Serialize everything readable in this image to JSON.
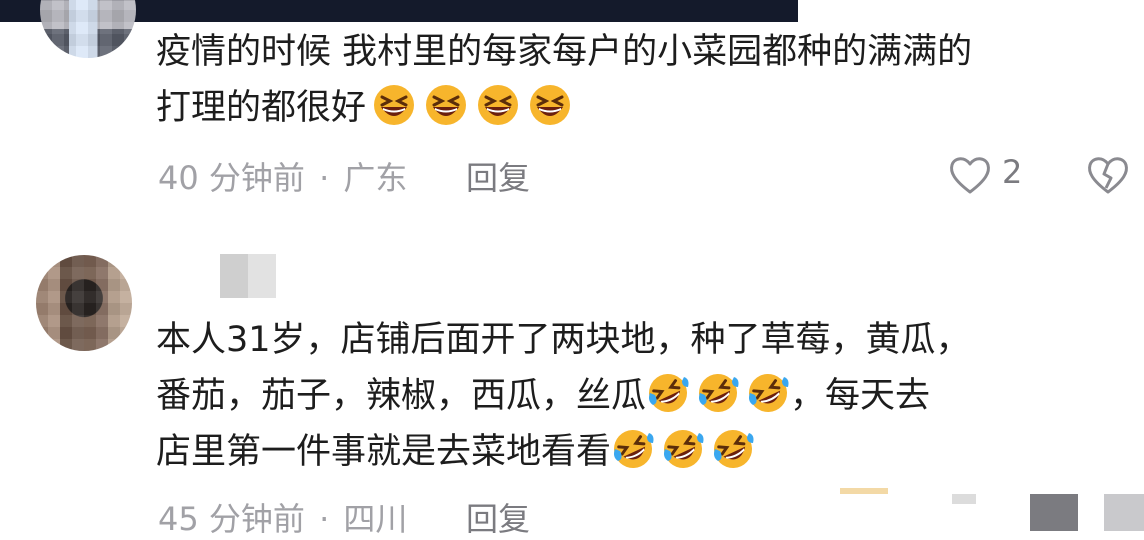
{
  "comments": [
    {
      "text_line1": "疫情的时候 我村里的每家每户的小菜园都种的满满的",
      "text_line2": "打理的都很好",
      "emoji_line2": [
        "grinning-squint-face",
        "grinning-squint-face",
        "grinning-squint-face",
        "grinning-squint-face"
      ],
      "time": "40 分钟前",
      "separator": "·",
      "location": "广东",
      "reply_label": "回复",
      "like_count": "2"
    },
    {
      "text_line1": "本人31岁，店铺后面开了两块地，种了草莓，黄瓜，",
      "text_line2_a": "番茄，茄子，辣椒，西瓜，丝瓜",
      "emoji_line2": [
        "rolling-on-floor-laughing",
        "rolling-on-floor-laughing",
        "rolling-on-floor-laughing"
      ],
      "text_line2_b": "，每天去",
      "text_line3": "店里第一件事就是去菜地看看",
      "emoji_line3": [
        "rolling-on-floor-laughing",
        "rolling-on-floor-laughing",
        "rolling-on-floor-laughing"
      ],
      "time": "45 分钟前",
      "separator": "·",
      "location": "四川",
      "reply_label": "回复"
    }
  ],
  "icons": {
    "like": "heart-outline-icon",
    "dislike": "broken-heart-icon"
  },
  "colors": {
    "emoji_yellow": "#f7b52c",
    "emoji_orange": "#f08a1c",
    "tear_blue": "#3aa7ef",
    "meta_gray": "#a1a1a6",
    "top_bar": "#141a2b"
  }
}
